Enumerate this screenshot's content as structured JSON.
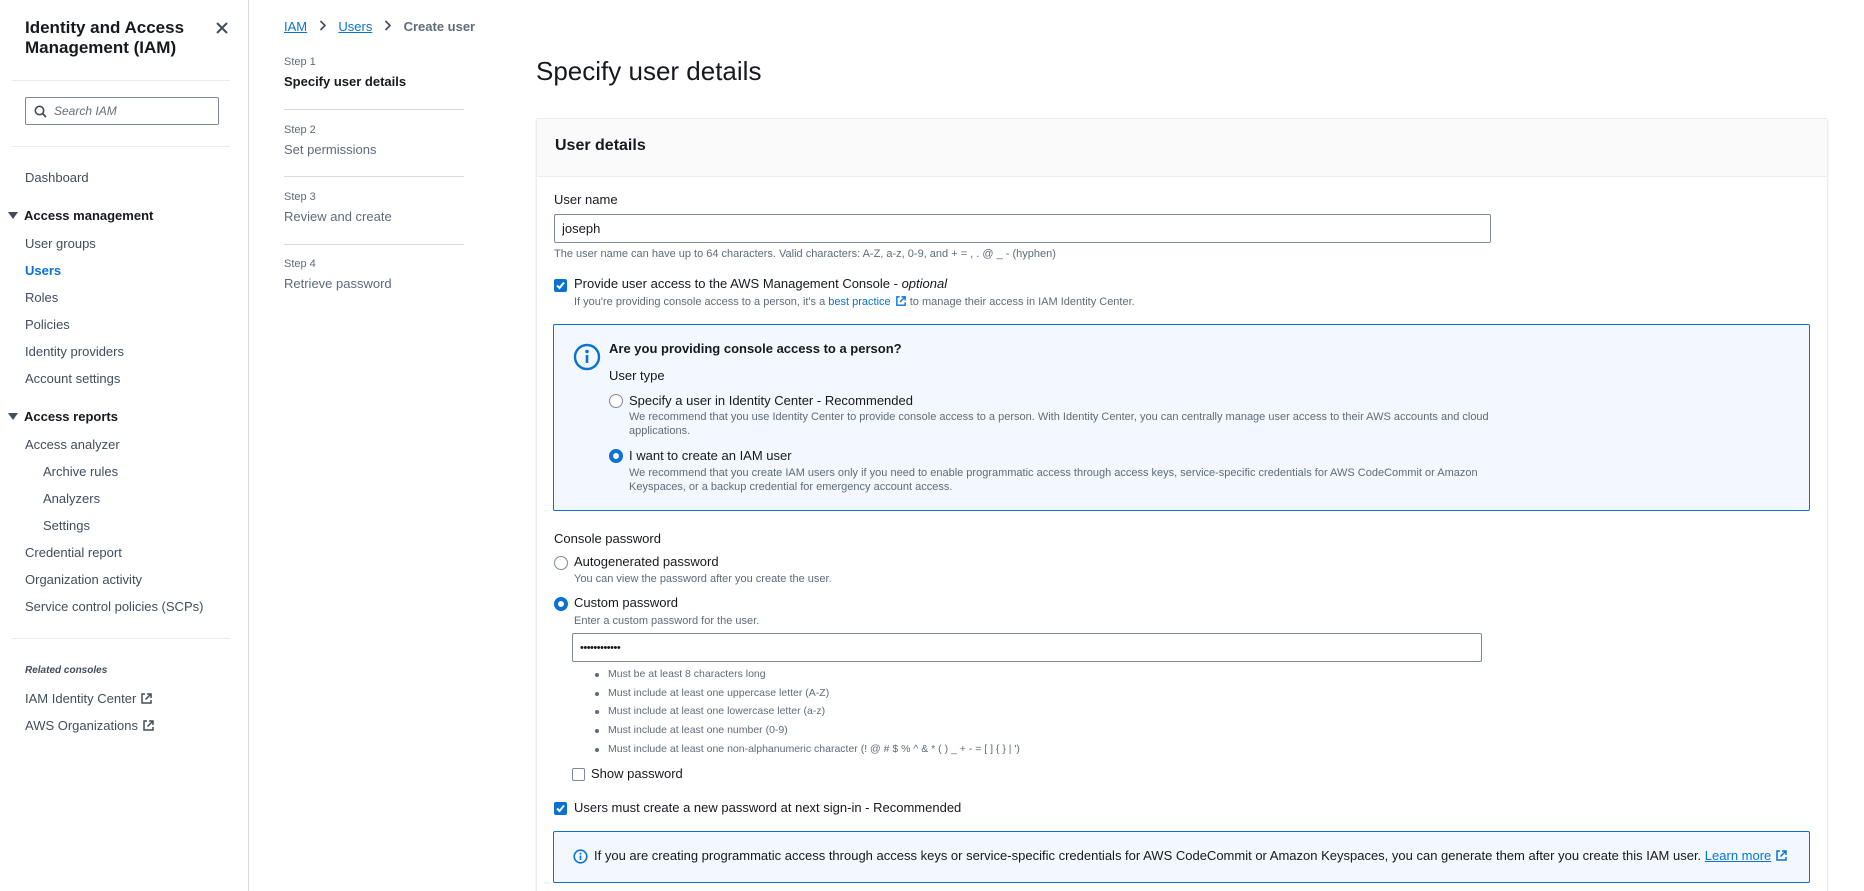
{
  "sidebar": {
    "title": "Identity and Access Management (IAM)",
    "search_placeholder": "Search IAM",
    "dashboard": "Dashboard",
    "access_management": {
      "label": "Access management",
      "items": [
        "User groups",
        "Users",
        "Roles",
        "Policies",
        "Identity providers",
        "Account settings"
      ],
      "active": "Users"
    },
    "access_reports": {
      "label": "Access reports",
      "items": [
        "Access analyzer",
        "Archive rules",
        "Analyzers",
        "Settings",
        "Credential report",
        "Organization activity",
        "Service control policies (SCPs)"
      ]
    },
    "related_consoles_label": "Related consoles",
    "related_consoles": [
      "IAM Identity Center",
      "AWS Organizations"
    ]
  },
  "breadcrumb": {
    "items": [
      "IAM",
      "Users"
    ],
    "current": "Create user"
  },
  "steps": [
    {
      "num": "Step 1",
      "name": "Specify user details",
      "current": true
    },
    {
      "num": "Step 2",
      "name": "Set permissions",
      "current": false
    },
    {
      "num": "Step 3",
      "name": "Review and create",
      "current": false
    },
    {
      "num": "Step 4",
      "name": "Retrieve password",
      "current": false
    }
  ],
  "page_title": "Specify user details",
  "user_details": {
    "header": "User details",
    "username_label": "User name",
    "username_value": "joseph",
    "username_hint": "The user name can have up to 64 characters. Valid characters: A-Z, a-z, 0-9, and + = , . @ _ - (hyphen)",
    "console_access_label": "Provide user access to the AWS Management Console - ",
    "console_access_optional": "optional",
    "console_access_checked": true,
    "best_practice_prefix": "If you're providing console access to a person, it's a ",
    "best_practice_link": "best practice",
    "best_practice_suffix": " to manage their access in IAM Identity Center."
  },
  "info_box": {
    "title": "Are you providing console access to a person?",
    "user_type_label": "User type",
    "option1_label": "Specify a user in Identity Center - Recommended",
    "option1_desc": "We recommend that you use Identity Center to provide console access to a person. With Identity Center, you can centrally manage user access to their AWS accounts and cloud applications.",
    "option2_label": "I want to create an IAM user",
    "option2_desc": "We recommend that you create IAM users only if you need to enable programmatic access through access keys, service-specific credentials for AWS CodeCommit or Amazon Keyspaces, or a backup credential for emergency account access.",
    "selected": "option2"
  },
  "console_password": {
    "label": "Console password",
    "auto_label": "Autogenerated password",
    "auto_desc": "You can view the password after you create the user.",
    "custom_label": "Custom password",
    "custom_desc": "Enter a custom password for the user.",
    "selected": "custom",
    "password_value": "••••••••••••",
    "rules": [
      "Must be at least 8 characters long",
      "Must include at least one uppercase letter (A-Z)",
      "Must include at least one lowercase letter (a-z)",
      "Must include at least one number (0-9)",
      "Must include at least one non-alphanumeric character (! @ # $ % ^ & * ( ) _ + - = [ ] { } | ')"
    ],
    "show_password_label": "Show password",
    "show_password_checked": false,
    "must_reset_label": "Users must create a new password at next sign-in - Recommended",
    "must_reset_checked": true
  },
  "info_box2": {
    "text": "If you are creating programmatic access through access keys or service-specific credentials for AWS CodeCommit or Amazon Keyspaces, you can generate them after you create this IAM user. ",
    "link": "Learn more"
  },
  "colors": {
    "accent": "#0972d3",
    "info_bg": "#f2f8fd",
    "text": "#16191f",
    "muted": "#5f6b7a"
  }
}
